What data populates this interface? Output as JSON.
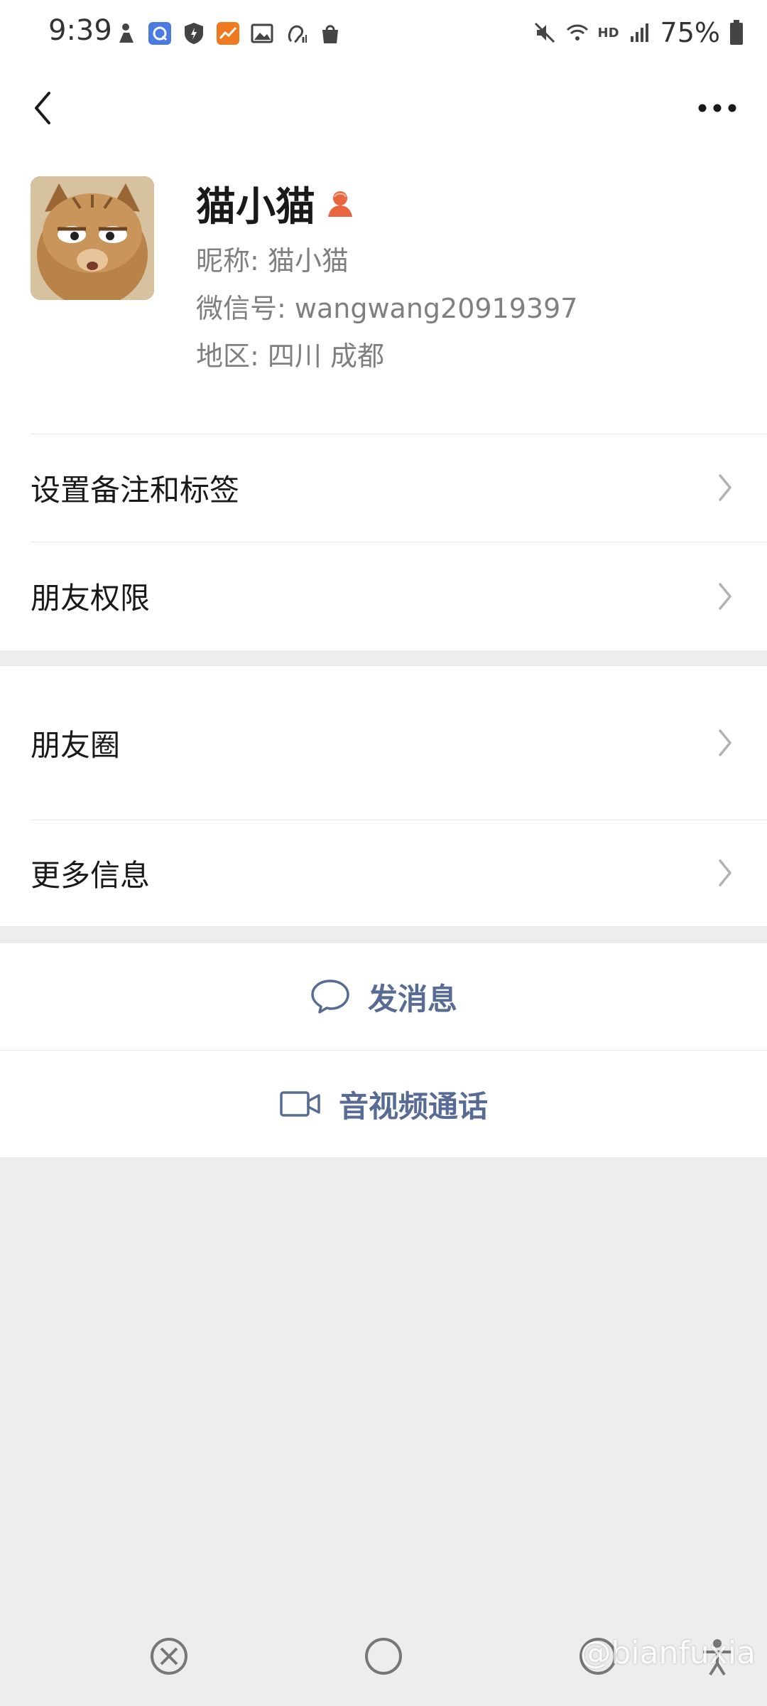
{
  "status_bar": {
    "time": "9:39",
    "left_icons": [
      "person-icon",
      "q-app-icon",
      "shield-icon",
      "chart-app-icon",
      "image-icon",
      "hearing-icon",
      "shopping-bag-icon"
    ],
    "right_icons": [
      "mute-icon",
      "wifi-icon",
      "hd-icon",
      "signal-icon"
    ],
    "hd_label": "HD",
    "battery": "75%"
  },
  "header": {
    "back_icon": "chevron-left-icon",
    "more_icon": "more-dots-icon"
  },
  "profile": {
    "name": "猫小猫",
    "gender_icon": "female-icon",
    "nickname": "昵称:  猫小猫",
    "wechat_id": "微信号:  wangwang20919397",
    "region": "地区:  四川  成都"
  },
  "list": {
    "remark_tags": "设置备注和标签",
    "friend_permissions": "朋友权限",
    "moments": "朋友圈",
    "more_info": "更多信息"
  },
  "actions": {
    "send_message": "发消息",
    "video_call": "音视频通话"
  },
  "colors": {
    "accent": "#576b95",
    "background": "#ededed",
    "gender_icon": "#e9653f"
  },
  "nav_bar": {
    "icons": [
      "close-circle-icon",
      "home-circle-icon",
      "back-icon",
      "accessibility-icon"
    ]
  },
  "watermark": "@bianfuxia"
}
